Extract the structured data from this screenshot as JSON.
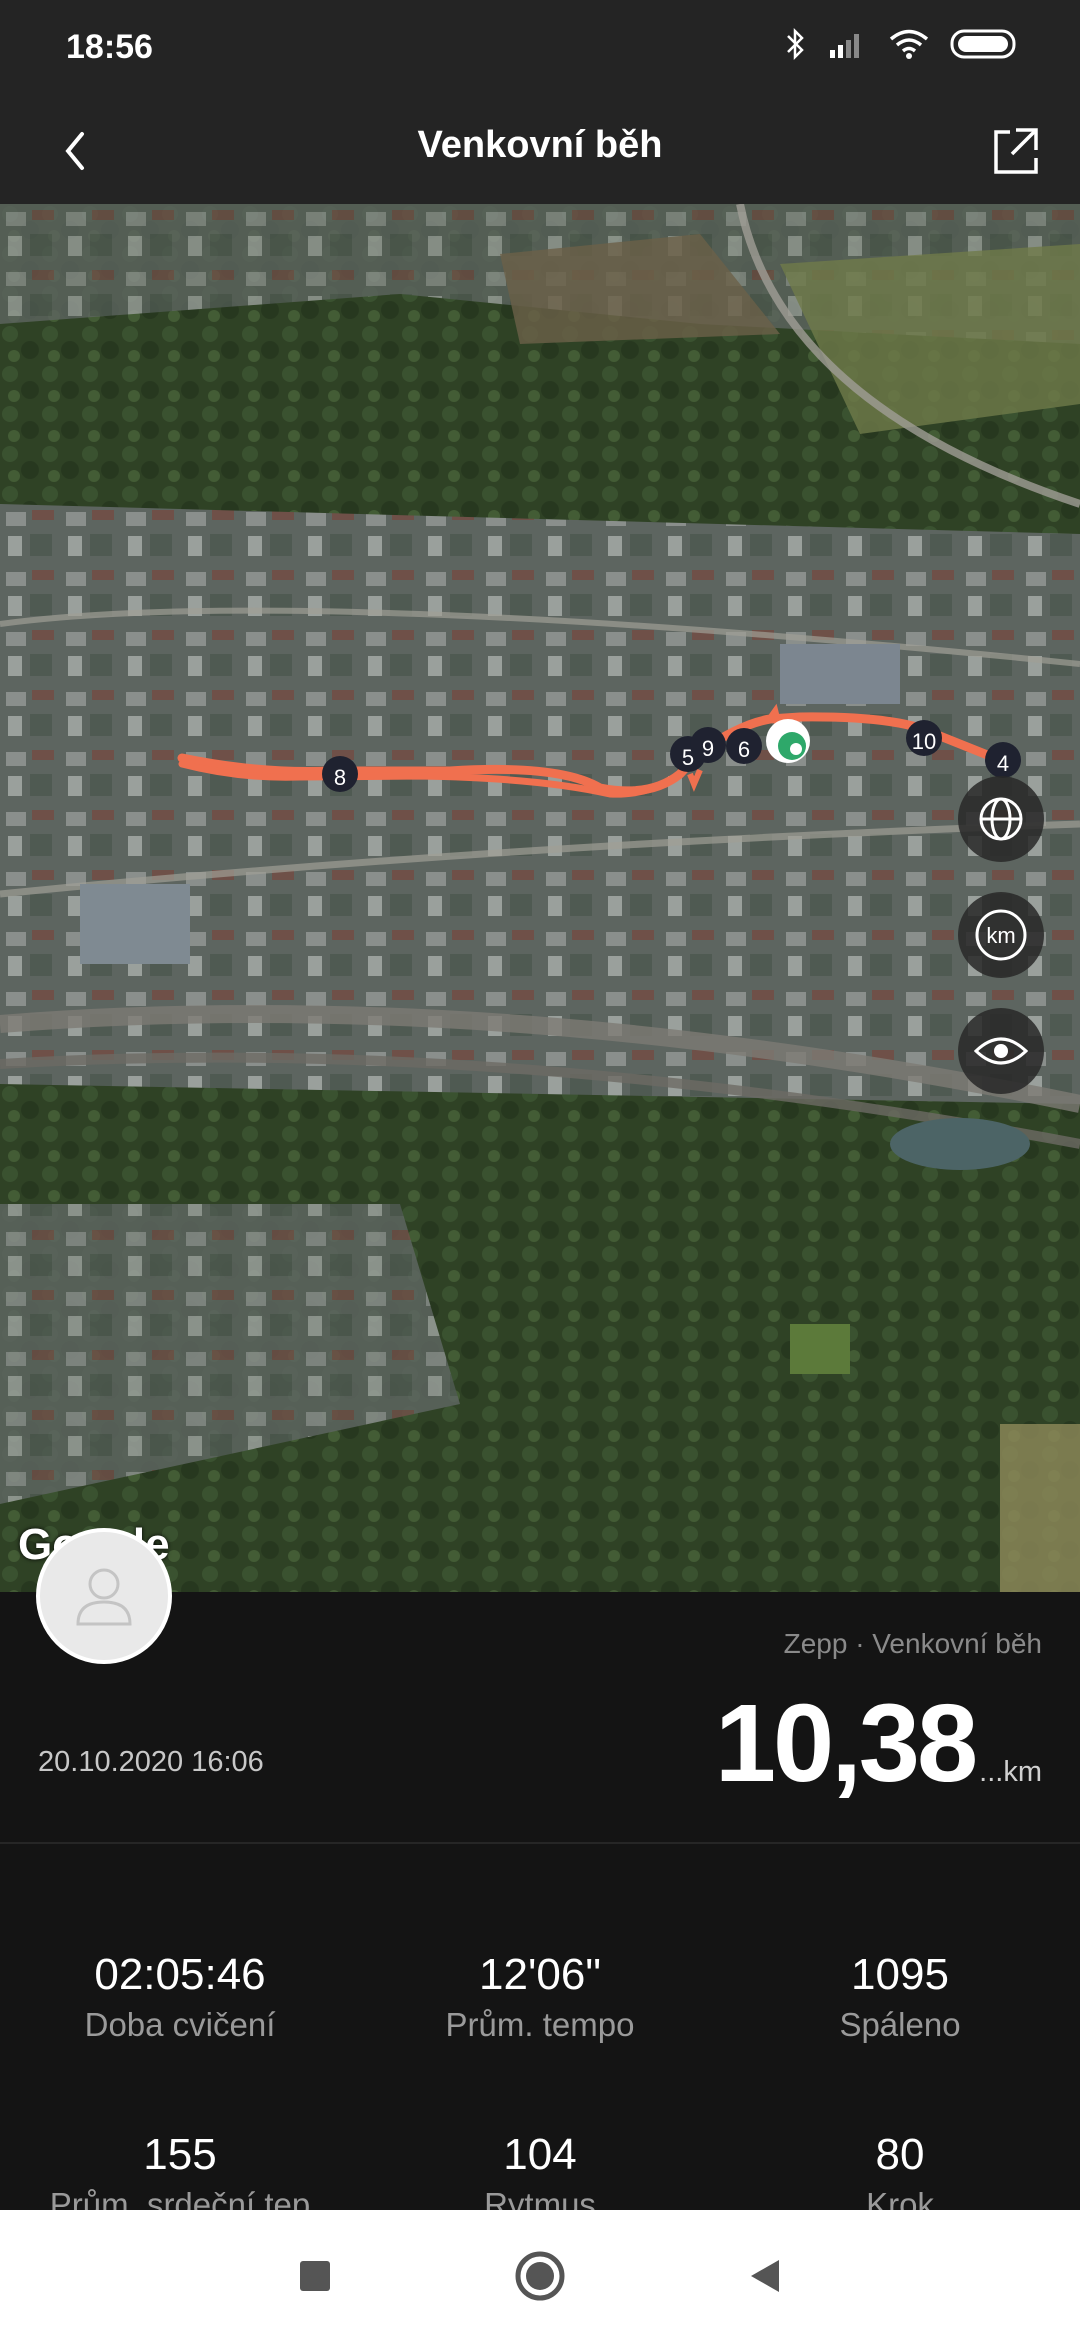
{
  "status_bar": {
    "time": "18:56",
    "icons": [
      "bluetooth-icon",
      "signal-icon",
      "wifi-icon",
      "battery-icon"
    ]
  },
  "app_bar": {
    "title": "Venkovní běh",
    "back_icon": "chevron-left-icon",
    "share_icon": "share-icon"
  },
  "map": {
    "route_color": "#f0704f",
    "km_markers": [
      "8",
      "5",
      "9",
      "6",
      "10",
      "4"
    ],
    "google_label": "Google",
    "controls": [
      {
        "name": "globe-button",
        "icon": "globe-icon"
      },
      {
        "name": "km-button",
        "label": "km"
      },
      {
        "name": "eye-button",
        "icon": "eye-icon"
      }
    ]
  },
  "summary": {
    "source": "Zepp · Venkovní běh",
    "date": "20.10.2020 16:06",
    "distance": "10,38",
    "unit": "...km"
  },
  "stats": [
    {
      "value": "02:05:46",
      "label": "Doba cvičení"
    },
    {
      "value": "12'06\"",
      "label": "Prům. tempo"
    },
    {
      "value": "1095",
      "label": "Spáleno"
    },
    {
      "value": "155",
      "label": "Prům. srdeční tep"
    },
    {
      "value": "104",
      "label": "Rytmus"
    },
    {
      "value": "80",
      "label": "Krok"
    }
  ],
  "nav_bar": {
    "buttons": [
      "recent-apps-icon",
      "home-icon",
      "back-icon"
    ]
  }
}
